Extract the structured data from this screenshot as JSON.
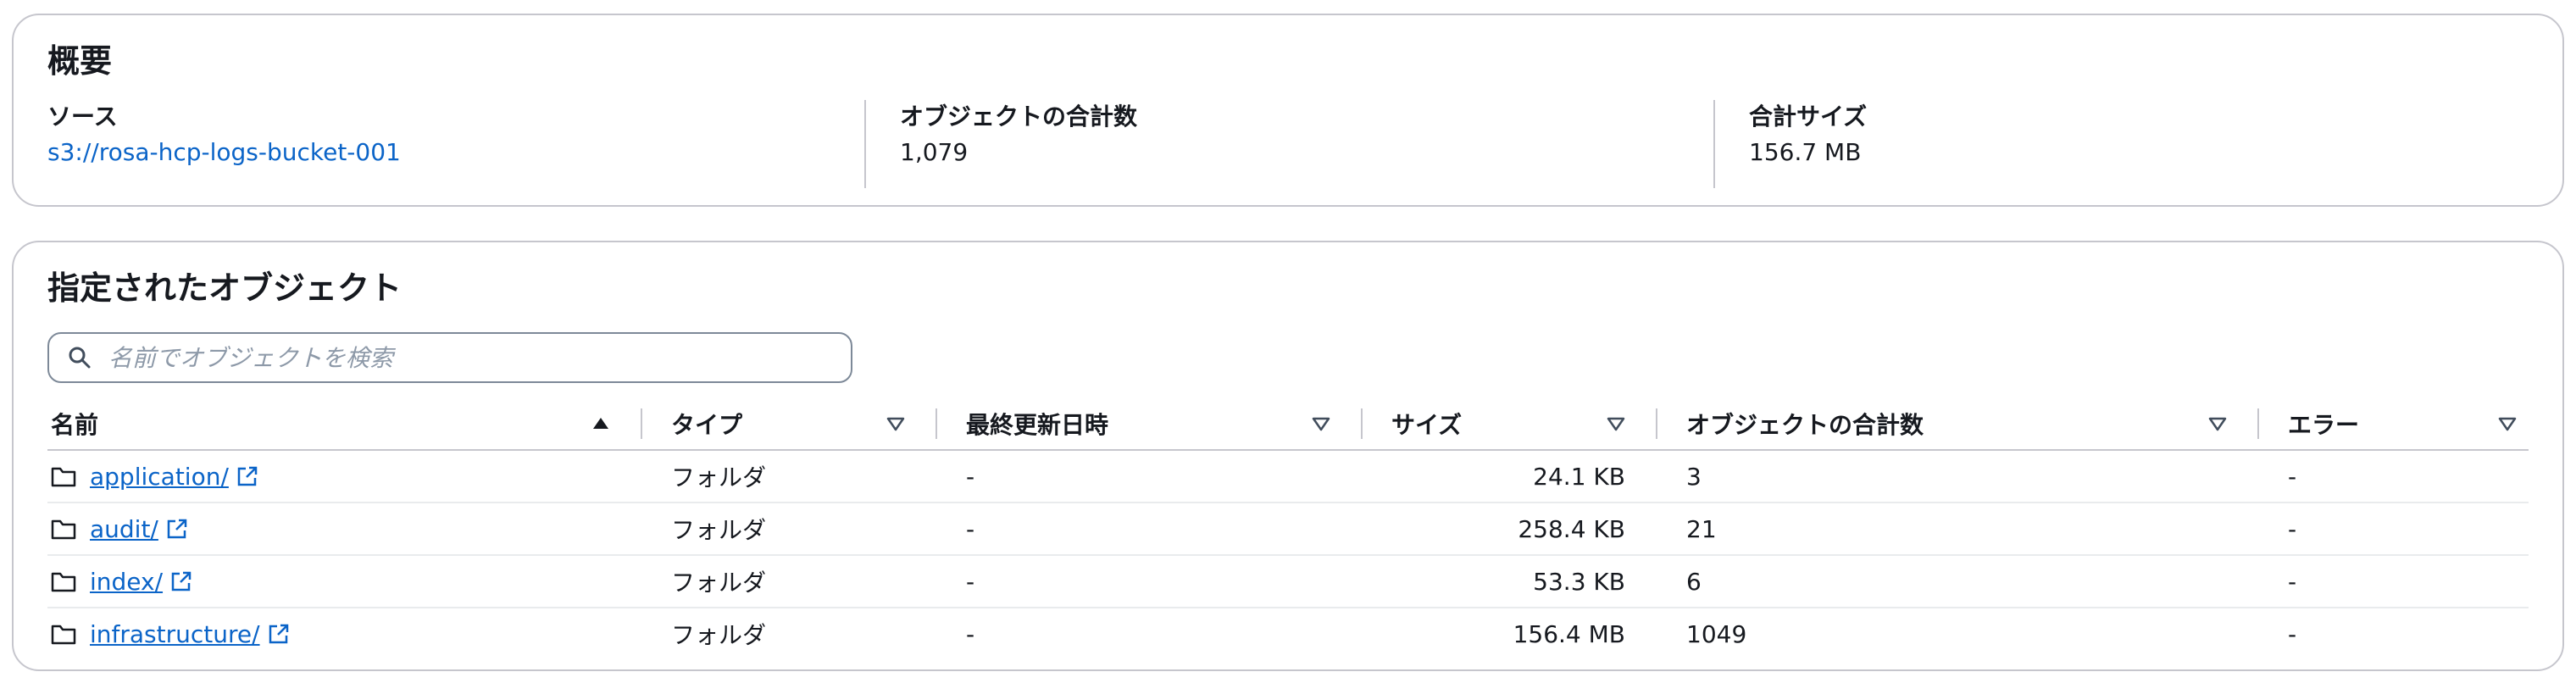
{
  "summary": {
    "title": "概要",
    "source_label": "ソース",
    "source_value": "s3://rosa-hcp-logs-bucket-001",
    "total_objects_label": "オブジェクトの合計数",
    "total_objects_value": "1,079",
    "total_size_label": "合計サイズ",
    "total_size_value": "156.7 MB"
  },
  "objects": {
    "title": "指定されたオブジェクト",
    "search_placeholder": "名前でオブジェクトを検索",
    "columns": [
      {
        "label": "名前",
        "sort": "ascending"
      },
      {
        "label": "タイプ",
        "sort": "none"
      },
      {
        "label": "最終更新日時",
        "sort": "none"
      },
      {
        "label": "サイズ",
        "sort": "none"
      },
      {
        "label": "オブジェクトの合計数",
        "sort": "none"
      },
      {
        "label": "エラー",
        "sort": "none"
      }
    ],
    "rows": [
      {
        "name": "application/",
        "type": "フォルダ",
        "modified": "-",
        "size": "24.1 KB",
        "count": "3",
        "error": "-"
      },
      {
        "name": "audit/",
        "type": "フォルダ",
        "modified": "-",
        "size": "258.4 KB",
        "count": "21",
        "error": "-"
      },
      {
        "name": "index/",
        "type": "フォルダ",
        "modified": "-",
        "size": "53.3 KB",
        "count": "6",
        "error": "-"
      },
      {
        "name": "infrastructure/",
        "type": "フォルダ",
        "modified": "-",
        "size": "156.4 MB",
        "count": "1049",
        "error": "-"
      }
    ]
  },
  "icons": {
    "search": "search-icon",
    "folder": "folder-icon",
    "external": "external-link-icon",
    "sort_asc": "sort-ascending-icon",
    "sort": "sort-icon"
  },
  "colors": {
    "link": "#0b64c8",
    "border": "#c6c6cd",
    "text": "#16191f"
  }
}
